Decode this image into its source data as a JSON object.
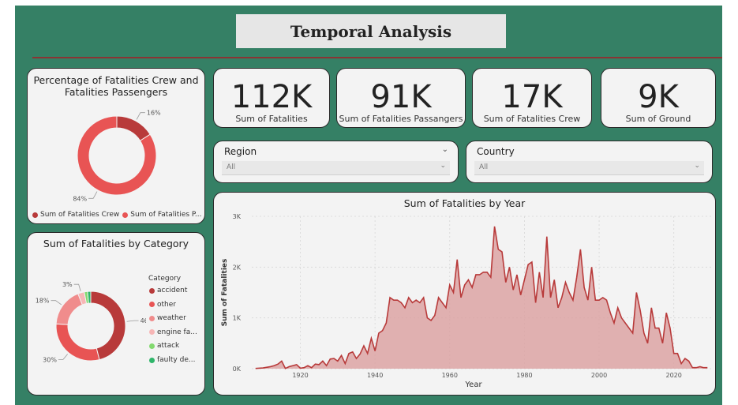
{
  "header": {
    "title": "Temporal Analysis"
  },
  "kpis": [
    {
      "value": "112K",
      "label": "Sum of Fatalities"
    },
    {
      "value": "91K",
      "label": "Sum of Fatalities Passangers"
    },
    {
      "value": "17K",
      "label": "Sum of Fatalities Crew"
    },
    {
      "value": "9K",
      "label": "Sum of Ground"
    }
  ],
  "slicers": [
    {
      "title": "Region",
      "value": "All"
    },
    {
      "title": "Country",
      "value": "All"
    }
  ],
  "donut1": {
    "title_line1": "Percentage of Fatalities Crew and",
    "title_line2": "Fatalities Passengers",
    "legend": [
      "Sum of Fatalities Crew",
      "Sum of Fatalities P..."
    ],
    "chevron": "chevron-down-icon"
  },
  "donut2": {
    "title": "Sum of Fatalities by Category",
    "legend_title": "Category",
    "legend": [
      "accident",
      "other",
      "weather",
      "engine fa...",
      "attack",
      "faulty de..."
    ]
  },
  "area_title": "Sum of Fatalities by Year",
  "colors": {
    "background": "#358065",
    "rule": "#8b3434",
    "area_line": "#b83a3a",
    "area_fill": "#dca3a3"
  },
  "chart_data": [
    {
      "type": "pie",
      "title": "Percentage of Fatalities Crew and Fatalities Passengers",
      "categories": [
        "Sum of Fatalities Crew",
        "Sum of Fatalities P..."
      ],
      "values": [
        16,
        84
      ],
      "labels": [
        "16%",
        "84%"
      ],
      "colors": [
        "#b83a3a",
        "#e85454"
      ],
      "legend": "bottom"
    },
    {
      "type": "pie",
      "title": "Sum of Fatalities by Category",
      "categories": [
        "accident",
        "other",
        "weather",
        "engine fa...",
        "attack",
        "faulty de..."
      ],
      "values": [
        46,
        30,
        18,
        3,
        1.5,
        1.5
      ],
      "labels": [
        "46%",
        "30%",
        "18%",
        "3%",
        "",
        ""
      ],
      "colors": [
        "#b83a3a",
        "#e85454",
        "#f08c8c",
        "#f7b6b6",
        "#82d96f",
        "#2fb56a"
      ],
      "legend": "right"
    },
    {
      "type": "area",
      "title": "Sum of Fatalities by Year",
      "xlabel": "Year",
      "ylabel": "Sum of Fatalities",
      "xlim": [
        1907,
        2030
      ],
      "ylim": [
        0,
        3000
      ],
      "xticks": [
        1920,
        1940,
        1960,
        1980,
        2000,
        2020
      ],
      "yticks": [
        0,
        1000,
        2000,
        3000
      ],
      "ytick_labels": [
        "0K",
        "1K",
        "2K",
        "3K"
      ],
      "grid": true,
      "x": [
        1908,
        1910,
        1912,
        1913,
        1914,
        1915,
        1916,
        1917,
        1918,
        1919,
        1920,
        1921,
        1922,
        1923,
        1924,
        1925,
        1926,
        1927,
        1928,
        1929,
        1930,
        1931,
        1932,
        1933,
        1934,
        1935,
        1936,
        1937,
        1938,
        1939,
        1940,
        1941,
        1942,
        1943,
        1944,
        1945,
        1946,
        1947,
        1948,
        1949,
        1950,
        1951,
        1952,
        1953,
        1954,
        1955,
        1956,
        1957,
        1958,
        1959,
        1960,
        1961,
        1962,
        1963,
        1964,
        1965,
        1966,
        1967,
        1968,
        1969,
        1970,
        1971,
        1972,
        1973,
        1974,
        1975,
        1976,
        1977,
        1978,
        1979,
        1980,
        1981,
        1982,
        1983,
        1984,
        1985,
        1986,
        1987,
        1988,
        1989,
        1990,
        1991,
        1992,
        1993,
        1994,
        1995,
        1996,
        1997,
        1998,
        1999,
        2000,
        2001,
        2002,
        2003,
        2004,
        2005,
        2006,
        2007,
        2008,
        2009,
        2010,
        2011,
        2012,
        2013,
        2014,
        2015,
        2016,
        2017,
        2018,
        2019,
        2020,
        2021,
        2022,
        2023,
        2024,
        2025,
        2026,
        2027,
        2028,
        2029
      ],
      "values": [
        5,
        15,
        40,
        60,
        90,
        150,
        5,
        40,
        60,
        80,
        10,
        20,
        60,
        20,
        90,
        80,
        150,
        60,
        190,
        200,
        150,
        260,
        100,
        300,
        330,
        200,
        290,
        450,
        300,
        600,
        350,
        700,
        750,
        900,
        1400,
        1350,
        1350,
        1300,
        1200,
        1400,
        1300,
        1350,
        1300,
        1400,
        1000,
        950,
        1050,
        1400,
        1300,
        1200,
        1650,
        1500,
        2150,
        1400,
        1650,
        1750,
        1600,
        1850,
        1850,
        1900,
        1900,
        1800,
        2800,
        2350,
        2300,
        1700,
        2000,
        1550,
        1850,
        1450,
        1750,
        2050,
        2100,
        1300,
        1900,
        1400,
        2600,
        1400,
        1750,
        1200,
        1400,
        1700,
        1500,
        1350,
        1800,
        2350,
        1600,
        1350,
        2000,
        1350,
        1350,
        1400,
        1350,
        1100,
        900,
        1200,
        1000,
        900,
        800,
        700,
        1500,
        1150,
        700,
        500,
        1200,
        800,
        800,
        500,
        1100,
        800,
        300,
        300,
        100,
        200,
        150,
        20,
        20,
        40,
        20,
        20,
        80,
        50
      ]
    }
  ]
}
